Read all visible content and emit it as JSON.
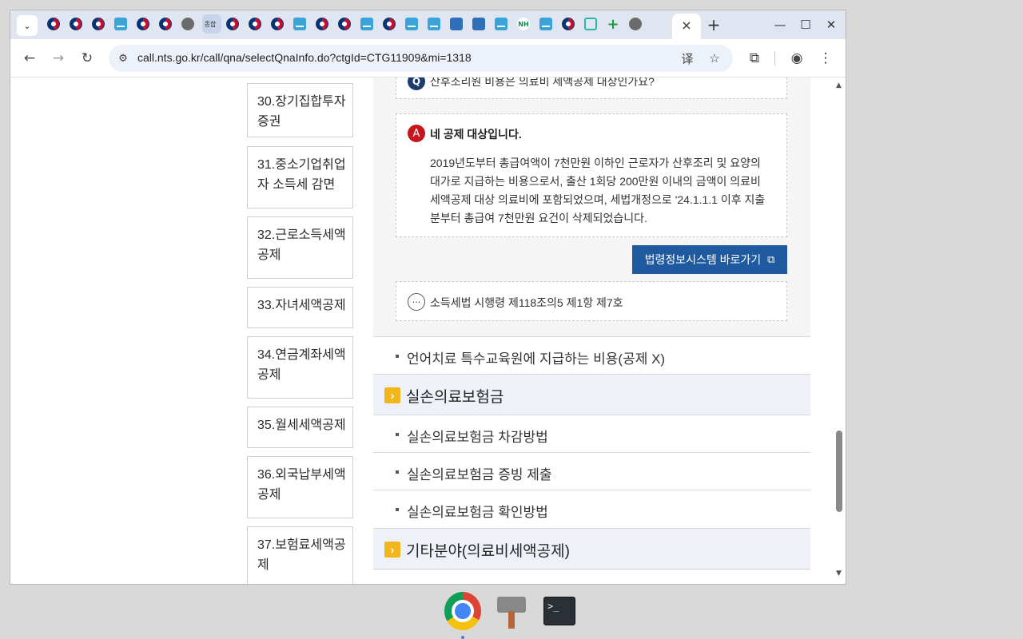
{
  "browser": {
    "url": "call.nts.go.kr/call/qna/selectQnaInfo.do?ctgId=CTG11909&mi=1318",
    "active_tab_close": "×",
    "new_tab": "+",
    "favicons": [
      "kr",
      "kr",
      "kr",
      "hts",
      "kr",
      "kr",
      "globe",
      "selected",
      "kr",
      "kr",
      "kr",
      "hts",
      "kr",
      "kr",
      "hts",
      "kr",
      "hts",
      "hts",
      "blue2",
      "blue2",
      "hts",
      "nh",
      "hts",
      "kr",
      "home",
      "plus",
      "globe"
    ],
    "selected_favicon_text": "종합"
  },
  "sidebar": {
    "items": [
      "30.장기집합투자증권",
      "31.중소기업취업자 소득세 감면",
      "32.근로소득세액공제",
      "33.자녀세액공제",
      "34.연금계좌세액공제",
      "35.월세세액공제",
      "36.외국납부세액공제",
      "37.보험료세액공제"
    ]
  },
  "qa": {
    "question_icon": "Q",
    "question": "산후조리원 비용은 의료비 세액공제 대상인가요?",
    "answer_icon": "A",
    "answer_title": "네 공제 대상입니다.",
    "answer_body": "2019년도부터 총급여액이 7천만원 이하인 근로자가 산후조리 및 요양의 대가로 지급하는 비용으로서, 출산 1회당 200만원 이내의 금액이 의료비 세액공제 대상 의료비에 포함되었으며, 세법개정으로 '24.1.1.1 이후 지출분부터 총급여 7천만원 요건이 삭제되었습니다.",
    "law_button": "법령정보시스템 바로가기",
    "reference_icon": "···",
    "reference": "소득세법 시행령 제118조의5 제1항 제7호"
  },
  "list": {
    "item_1": "언어치료 특수교육원에 지급하는 비용(공제 X)",
    "category_1": "실손의료보험금",
    "category_1_items": [
      "실손의료보험금 차감방법",
      "실손의료보험금 증빙 제출",
      "실손의료보험금 확인방법"
    ],
    "category_2": "기타분야(의료비세액공제)"
  },
  "colors": {
    "law_button_bg": "#1f5aa0",
    "answer_icon": "#c4161c",
    "category_icon": "#f2b51c"
  }
}
